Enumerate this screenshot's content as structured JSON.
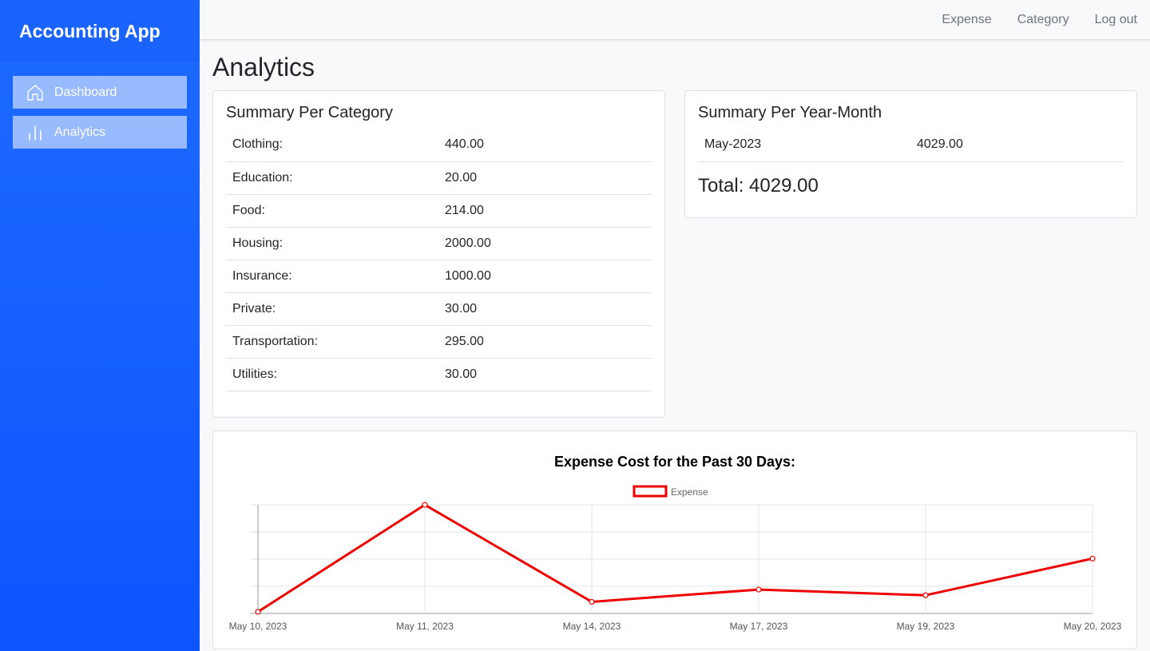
{
  "sidebar": {
    "brand": "Accounting App",
    "items": [
      {
        "label": "Dashboard",
        "icon": "home-icon"
      },
      {
        "label": "Analytics",
        "icon": "bar-chart-icon"
      }
    ]
  },
  "topnav": {
    "expense": "Expense",
    "category": "Category",
    "logout": "Log out"
  },
  "page": {
    "title": "Analytics"
  },
  "category_summary": {
    "title": "Summary Per Category",
    "rows": [
      {
        "name": "Clothing:",
        "value": "440.00"
      },
      {
        "name": "Education:",
        "value": "20.00"
      },
      {
        "name": "Food:",
        "value": "214.00"
      },
      {
        "name": "Housing:",
        "value": "2000.00"
      },
      {
        "name": "Insurance:",
        "value": "1000.00"
      },
      {
        "name": "Private:",
        "value": "30.00"
      },
      {
        "name": "Transportation:",
        "value": "295.00"
      },
      {
        "name": "Utilities:",
        "value": "30.00"
      }
    ]
  },
  "yearmonth_summary": {
    "title": "Summary Per Year-Month",
    "rows": [
      {
        "name": "May-2023",
        "value": "4029.00"
      }
    ],
    "total": "Total: 4029.00"
  },
  "colors": {
    "sidebar": "#1a63ff",
    "line": "#ee0000"
  },
  "chart_data": {
    "type": "line",
    "title": "Expense Cost for the Past 30 Days:",
    "legend_position": "top",
    "grid": true,
    "categories": [
      "May 10, 2023",
      "May 11, 2023",
      "May 14, 2023",
      "May 17, 2023",
      "May 19, 2023",
      "May 20, 2023"
    ],
    "series": [
      {
        "name": "Expense",
        "values": [
          30,
          2000,
          214,
          440,
          335,
          1010
        ]
      }
    ],
    "ylim": [
      0,
      2000
    ]
  }
}
